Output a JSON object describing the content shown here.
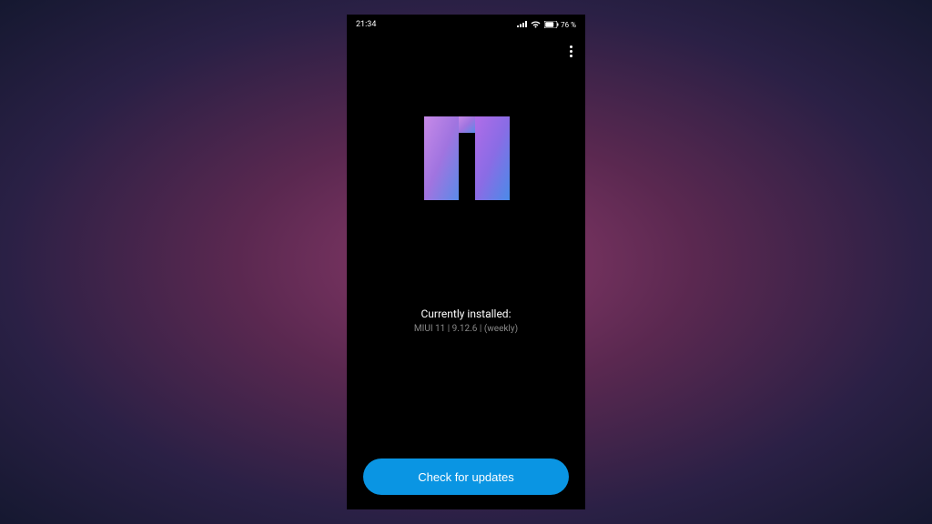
{
  "statusBar": {
    "time": "21:34",
    "batteryPercent": "76 %"
  },
  "icons": {
    "signal": "signal-icon",
    "wifi": "wifi-icon",
    "battery": "battery-icon",
    "more": "more-icon"
  },
  "version": {
    "label": "Currently installed:",
    "value": "MIUI 11 | 9.12.6 | (weekly)"
  },
  "actions": {
    "checkUpdates": "Check for updates"
  },
  "colors": {
    "accent": "#0a95e3",
    "logoGradientStart": "#b47ae0",
    "logoGradientEnd": "#4a8be8"
  }
}
